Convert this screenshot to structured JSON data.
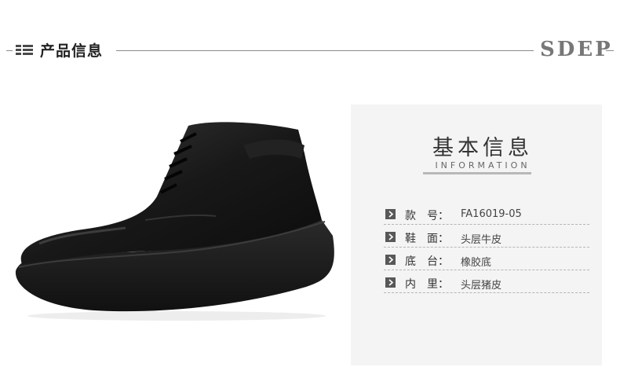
{
  "header": {
    "title": "产品信息",
    "brand": "SDEP"
  },
  "info": {
    "title": "基本信息",
    "subtitle": "INFORMATION",
    "rows": [
      {
        "label": "款　号：",
        "value": "FA16019-05"
      },
      {
        "label": "鞋　面：",
        "value": "头层牛皮"
      },
      {
        "label": "底　台：",
        "value": "橡胶底"
      },
      {
        "label": "内　里：",
        "value": "头层猪皮"
      }
    ]
  },
  "colors": {
    "header_rule": "#8a8a8a",
    "panel_bg": "#f4f4f4",
    "bullet": "#585858",
    "brand": "#777777"
  },
  "icons": {
    "header_icon": "menu-icon",
    "row_bullet": "chevron-right-icon"
  }
}
